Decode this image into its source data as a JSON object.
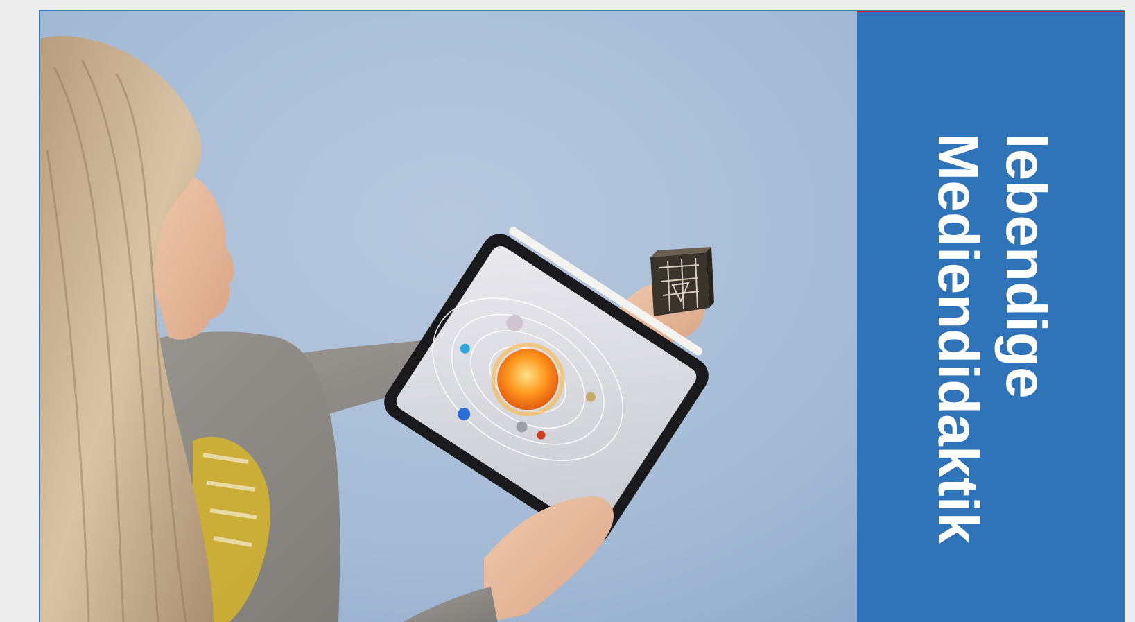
{
  "banner": {
    "line1": "lebendige",
    "line2": "Mediendidaktik",
    "background_color": "#2f73b9",
    "text_color": "#ffffff"
  },
  "photo": {
    "subject": "person holding tablet showing solar system augmented reality app and a patterned cube"
  }
}
